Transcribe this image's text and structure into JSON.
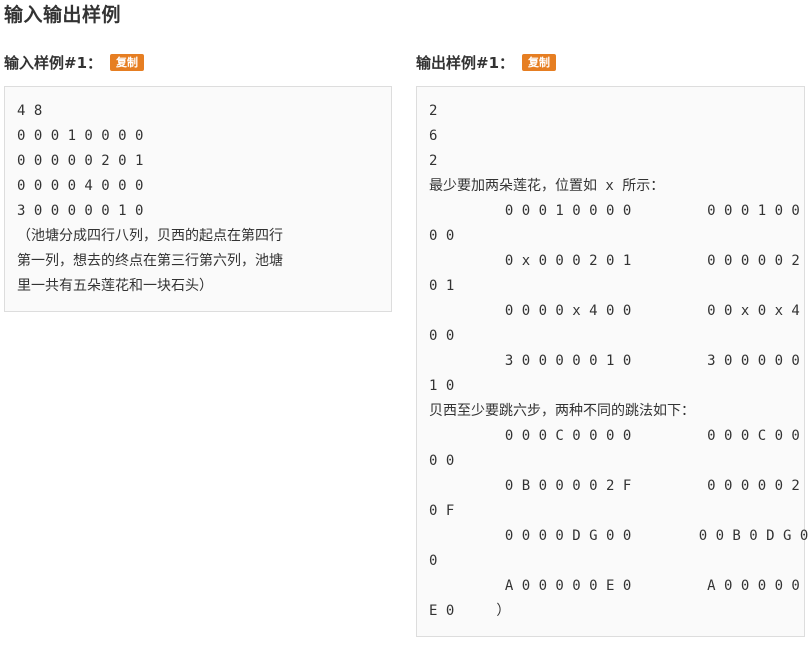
{
  "section": {
    "title": "输入输出样例"
  },
  "input_sample": {
    "label": "输入样例#1：",
    "copy_label": "复制",
    "content": "4 8\n0 0 0 1 0 0 0 0\n0 0 0 0 0 2 0 1\n0 0 0 0 4 0 0 0\n3 0 0 0 0 0 1 0\n（池塘分成四行八列，贝西的起点在第四行\n第一列，想去的终点在第三行第六列，池塘\n里一共有五朵莲花和一块石头）"
  },
  "output_sample": {
    "label": "输出样例#1：",
    "copy_label": "复制",
    "content": "2\n6\n2\n最少要加两朵莲花，位置如 x 所示：\n         0 0 0 1 0 0 0 0         0 0 0 1 0 0\n0 0\n         0 x 0 0 0 2 0 1         0 0 0 0 0 2\n0 1\n         0 0 0 0 x 4 0 0         0 0 x 0 x 4\n0 0\n         3 0 0 0 0 0 1 0         3 0 0 0 0 0\n1 0\n贝西至少要跳六步，两种不同的跳法如下：\n         0 0 0 C 0 0 0 0         0 0 0 C 0 0\n0 0\n         0 B 0 0 0 0 2 F         0 0 0 0 0 2\n0 F\n         0 0 0 0 D G 0 0        0 0 B 0 D G 0\n0\n         A 0 0 0 0 0 E 0         A 0 0 0 0 0\nE 0     ）"
  },
  "colors": {
    "copy_button": "#e67e22",
    "box_background": "#fafafa",
    "box_border": "#dddddd",
    "text": "#333333"
  }
}
